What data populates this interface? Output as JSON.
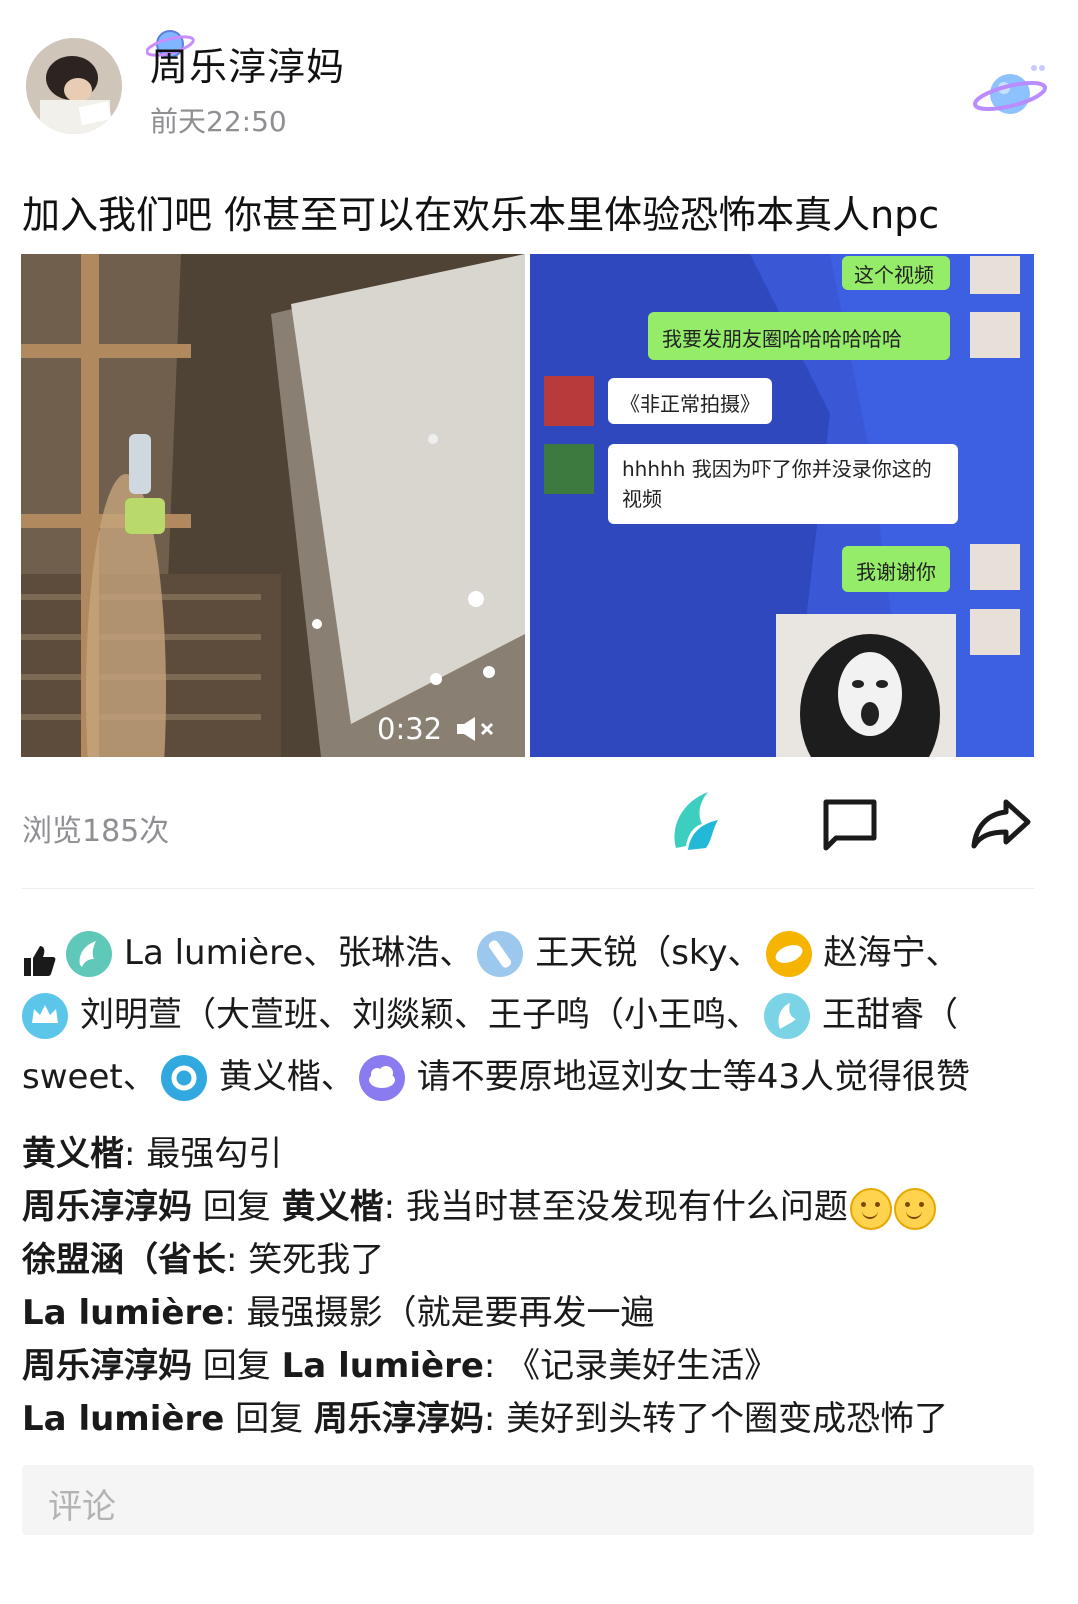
{
  "post": {
    "author": "周乐淳淳妈",
    "time": "前天22:50",
    "text": "加入我们吧 你甚至可以在欢乐本里体验恐怖本真人npc",
    "video": {
      "duration": "0:32",
      "muted_icon": "speaker-muted-icon"
    },
    "chat_screenshot": {
      "messages": [
        {
          "side": "right",
          "text": "这个视频"
        },
        {
          "side": "right",
          "text": "我要发朋友圈哈哈哈哈哈哈"
        },
        {
          "side": "left",
          "text": "《非正常拍摄》"
        },
        {
          "side": "left",
          "text": "hhhhh 我因为吓了你并没录你这的视频"
        },
        {
          "side": "right",
          "text": "我谢谢你"
        }
      ]
    }
  },
  "stats": {
    "views": "浏览185次",
    "icons": [
      "wing-like-icon",
      "comment-icon",
      "share-icon"
    ]
  },
  "likes": {
    "names": [
      "La lumière、",
      "张琳浩、",
      "王天锐（sky、",
      "赵海宁、",
      "刘明萱（大萱班、",
      "刘燚颖、",
      "王子鸣（小王鸣、",
      "王甜睿（",
      "sweet、",
      "黄义楷、",
      "请不要原地逗刘女士等43人觉得很赞"
    ],
    "badge_colors": [
      "#5fc8b8",
      "#9cc8ee",
      "#f5b400",
      "#5cc6ea",
      "#7ad4e6",
      "#32a8e0",
      "#8a7cf0"
    ]
  },
  "comments": [
    {
      "author": "黄义楷",
      "reply_word": "",
      "reply_to": "",
      "text": ": 最强勾引"
    },
    {
      "author": "周乐淳淳妈",
      "reply_word": " 回复 ",
      "reply_to": "黄义楷",
      "text": ": 我当时甚至没发现有什么问题"
    },
    {
      "author": "徐盟涵（省长",
      "reply_word": "",
      "reply_to": "",
      "text": ": 笑死我了"
    },
    {
      "author": "La lumière",
      "reply_word": "",
      "reply_to": "",
      "text": ": 最强摄影（就是要再发一遍"
    },
    {
      "author": "周乐淳淳妈",
      "reply_word": " 回复 ",
      "reply_to": "La lumière",
      "text": ": 《记录美好生活》"
    },
    {
      "author": "La lumière",
      "reply_word": " 回复 ",
      "reply_to": "周乐淳淳妈",
      "text": ": 美好到头转了个圈变成恐怖了"
    }
  ],
  "comment_input": {
    "placeholder": "评论"
  },
  "colors": {
    "accent_teal": "#2ec4b6",
    "chat_green": "#95ec69",
    "chat_bg_blue": "#3a58d6"
  }
}
